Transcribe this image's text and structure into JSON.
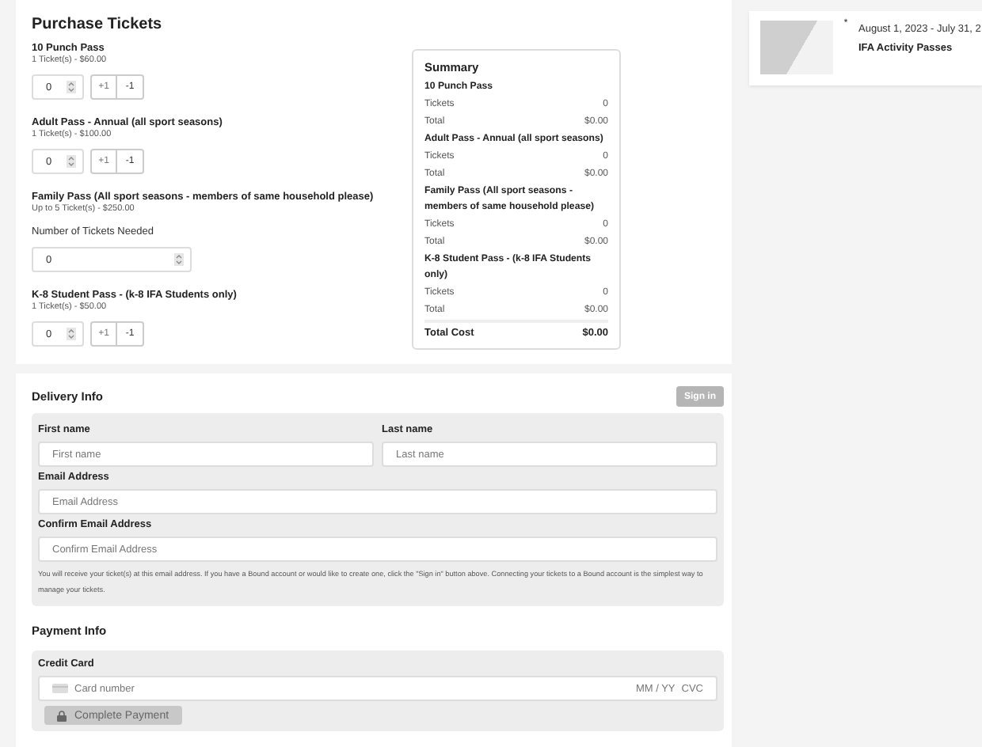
{
  "purchase": {
    "title": "Purchase Tickets",
    "tickets": [
      {
        "kind": "stepper",
        "name": "10 Punch Pass",
        "price": "1 Ticket(s) - $60.00",
        "value": "0",
        "plus": "+1",
        "minus": "-1"
      },
      {
        "kind": "stepper",
        "name": "Adult Pass - Annual (all sport seasons)",
        "price": "1 Ticket(s) - $100.00",
        "value": "0",
        "plus": "+1",
        "minus": "-1"
      },
      {
        "kind": "number",
        "name": "Family Pass (All sport seasons - members of same household please)",
        "price": "Up to 5 Ticket(s) - $250.00",
        "label": "Number of Tickets Needed",
        "value": "0"
      },
      {
        "kind": "stepper",
        "name": "K-8 Student Pass - (k-8 IFA Students only)",
        "price": "1 Ticket(s) - $50.00",
        "value": "0",
        "plus": "+1",
        "minus": "-1"
      }
    ]
  },
  "summary": {
    "title": "Summary",
    "items": [
      {
        "name": "10 Punch Pass",
        "tickets_label": "Tickets",
        "tickets": "0",
        "total_label": "Total",
        "total": "$0.00"
      },
      {
        "name": "Adult Pass - Annual (all sport seasons)",
        "tickets_label": "Tickets",
        "tickets": "0",
        "total_label": "Total",
        "total": "$0.00"
      },
      {
        "name": "Family Pass (All sport seasons - members of same household please)",
        "tickets_label": "Tickets",
        "tickets": "0",
        "total_label": "Total",
        "total": "$0.00"
      },
      {
        "name": "K-8 Student Pass - (k-8 IFA Students only)",
        "tickets_label": "Tickets",
        "tickets": "0",
        "total_label": "Total",
        "total": "$0.00"
      }
    ],
    "total_label": "Total Cost",
    "total": "$0.00"
  },
  "delivery": {
    "title": "Delivery Info",
    "sign_in": "Sign in",
    "fields": [
      {
        "label": "First name",
        "placeholder": "First name"
      },
      {
        "label": "Last name",
        "placeholder": "Last name"
      },
      {
        "label": "Email Address",
        "placeholder": "Email Address"
      },
      {
        "label": "Confirm Email Address",
        "placeholder": "Confirm Email Address"
      }
    ],
    "note": "You will receive your ticket(s) at this email address. If you have a Bound account or would like to create one, click the \"Sign in\" button above. Connecting your tickets to a Bound account is the simplest way to manage your tickets."
  },
  "payment": {
    "title": "Payment Info",
    "card_label": "Credit Card",
    "card_placeholder": "Card number",
    "expiry_placeholder": "MM / YY",
    "cvc_placeholder": "CVC",
    "button": "Complete Payment"
  },
  "event": {
    "marker": "*",
    "dates": "August 1, 2023 - July 31, 2",
    "title": "IFA Activity Passes"
  }
}
